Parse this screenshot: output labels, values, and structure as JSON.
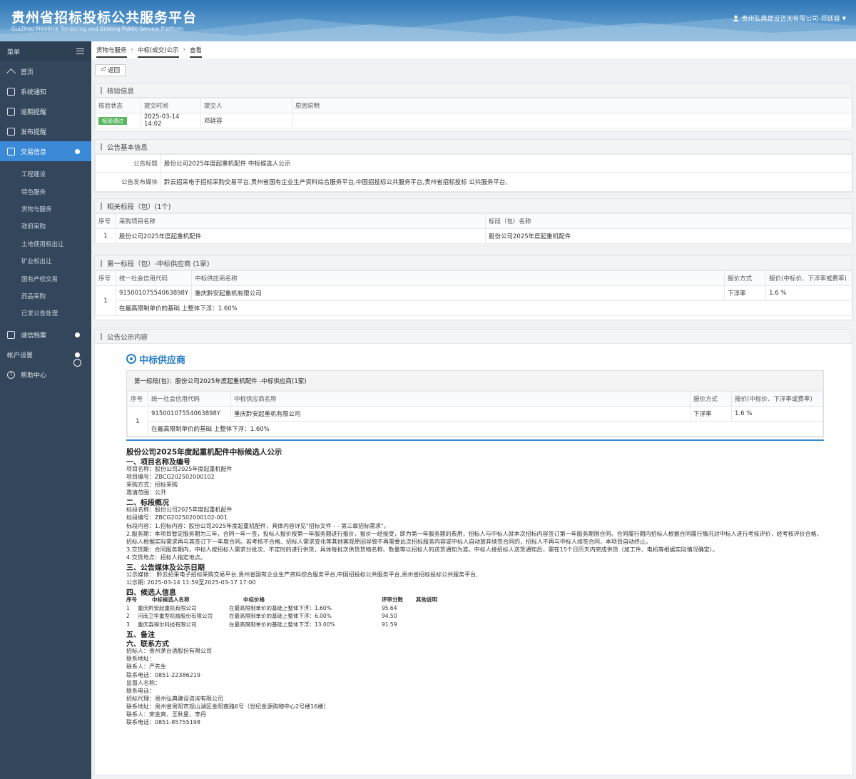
{
  "header": {
    "title": "贵州省招标投标公共服务平台",
    "subtitle": "GuiZhou Province Tendering and Bidding Public Service Platform",
    "user": "贵州弘典建设咨询有限公司-邓廷容"
  },
  "sidebar": {
    "menu_label": "菜单",
    "items": [
      {
        "label": "首页"
      },
      {
        "label": "系统通知"
      },
      {
        "label": "逾期提醒"
      },
      {
        "label": "发布提醒"
      },
      {
        "label": "交易信息"
      }
    ],
    "sub_items": [
      "工程建设",
      "特色服务",
      "货物与服务",
      "政府采购",
      "土地使用权出让",
      "矿业权出让",
      "国有产权交易",
      "药品采购",
      "已发公告处理"
    ],
    "bottom_items": [
      {
        "label": "诚信档案"
      },
      {
        "label": "帐户设置"
      },
      {
        "label": "帮助中心"
      }
    ]
  },
  "breadcrumb": [
    "货物与服务",
    "中标(成交)公示",
    "查看"
  ],
  "back_label": "返回",
  "verify": {
    "title": "核验信息",
    "headers": [
      "核验状态",
      "提交时间",
      "提交人",
      "原因说明"
    ],
    "status": "核验通过",
    "time": "2025-03-14 14:02",
    "person": "邓廷容",
    "reason": ""
  },
  "basic": {
    "title": "公告基本信息",
    "title_label": "公告标题",
    "title_value": "股份公司2025年度起重机配件 中标候选人公示",
    "media_label": "公告发布媒体",
    "media_value": "黔云招采电子招标采购交易平台,贵州省国有企业生产资料综合服务平台,中国招投标公共服务平台,贵州省招标投标 公共服务平台,"
  },
  "sections": {
    "title": "相关标段（包）(1个)",
    "headers": [
      "序号",
      "采购项目名称",
      "标段（包）名称"
    ],
    "row": {
      "no": "1",
      "project": "股份公司2025年度起重机配件",
      "lot": "股份公司2025年度起重机配件"
    }
  },
  "winner": {
    "title": "第一标段（包）-中标供应商 (1家)",
    "headers": [
      "序号",
      "统一社会信用代码",
      "中标供应商名称",
      "报价方式",
      "报价(中标价、下浮率或费率)"
    ],
    "no": "1",
    "code": "91500107554063898Y",
    "name": "重庆黔安起重机有限公司",
    "mode": "下浮率",
    "price": "1.6 %",
    "note": "在最高限制单价的基础 上整体下浮：1.60%"
  },
  "content": {
    "title": "公告公示内容",
    "win_heading": "中标供应商",
    "lot_heading": "第一标段(包)：股份公司2025年度起重机配件 -中标供应商(1家)",
    "headers": [
      "序号",
      "统一社会信用代码",
      "中标供应商名称",
      "报价方式",
      "报价(中标价、下浮率或费率)"
    ],
    "no": "1",
    "code": "91500107554063898Y",
    "name": "重庆黔安起重机有限公司",
    "mode": "下浮率",
    "price": "1.6 %",
    "note": "在最高限制单价的基础 上整体下浮：1.60%",
    "doc_title": "股份公司2025年度起重机配件中标候选人公示",
    "s1": "一、项目名称及编号",
    "s1_lines": [
      "项目名称：股份公司2025年度起重机配件",
      "项目编号：ZBCG202502000102",
      "采购方式：招标采购",
      "邀请范围：公开"
    ],
    "s2": "二、标段概况",
    "s2_lines": [
      "标段名称：股份公司2025年度起重机配件",
      "标段编号：ZBCG202502000102-001",
      "标段内容：1.招标内容：股份公司2025年度起重机配件，具体内容详见\"招标文件 - - 第三章招标需求\"。"
    ],
    "s2_para": "2.服务期：本项目暂定服务期为三年，合同一年一签，投标人报价按第一年服务期进行报价，报价一经接受，即为第一年服务期的费用，招标人与中标人就本次招标内容签订第一年服务期限合同。合同履行期内招标人根据合同履行情况对中标人进行考核评价，经考核评价合格，招标人根据实际需求再与其签订下一年度合同。若考核不合格、招标人需求变化等其他客观原因导致不再需要此次招标服务内容或中标人自动放弃续签合同的，招标人不再与中标人续签合同，本项目自动终止。",
    "s2_lines2": [
      "3.交货期：合同服务期内，中标人按招标人需求分批次、不定时的进行供货，具体每批次供货货物名称、数量等以招标人的送货通知为准。中标人接招标人送货通知后，需在15个日历天内完成供货（加工件、电机等根据实际情况确定）。",
      "4.交货地点：招标人指定地点。"
    ],
    "s3": "三、公告媒体及公示日期",
    "s3_lines": [
      "公示媒体： 黔云招采电子招标采购交易平台,贵州省国有企业生产资料综合服务平台,中国招投标公共服务平台,贵州省招标投标公共服务平台,",
      "公示期: 2025-03-14 11:59至2025-03-17 17:00"
    ],
    "s4": "四、候选人信息",
    "cand_headers": [
      "序号",
      "中标候选人名称",
      "中标价格",
      "评审分数",
      "其他说明"
    ],
    "candidates": [
      [
        "1",
        "重庆黔安起重机有限公司",
        "在最高限制单价的基础上整体下浮：1.60%",
        "95.64",
        ""
      ],
      [
        "2",
        "河南卫华重型机械股份有限公司",
        "在最高限制单价的基础上整体下浮：6.00%",
        "94.50",
        ""
      ],
      [
        "3",
        "重庆森得尔科技有限公司",
        "在最高限制单价的基础上整体下浮：13.00%",
        "91.59",
        ""
      ]
    ],
    "s5": "五、备注",
    "s6": "六、联系方式",
    "s6_lines": [
      "招标人：贵州茅台酒股份有限公司",
      "联系地址：",
      "联系人：严先生",
      "联系电话：0851-22386219",
      "监督人名称：",
      "联系电话：",
      "招标代理：贵州弘典建设咨询有限公司",
      "联系地址：贵州省贵阳市观山湖区金阳南路6号（世纪金源购物中心2号楼16楼）",
      "联系人：宋金爽、王秋星、李丹",
      "联系电话：0851-85755198"
    ]
  }
}
